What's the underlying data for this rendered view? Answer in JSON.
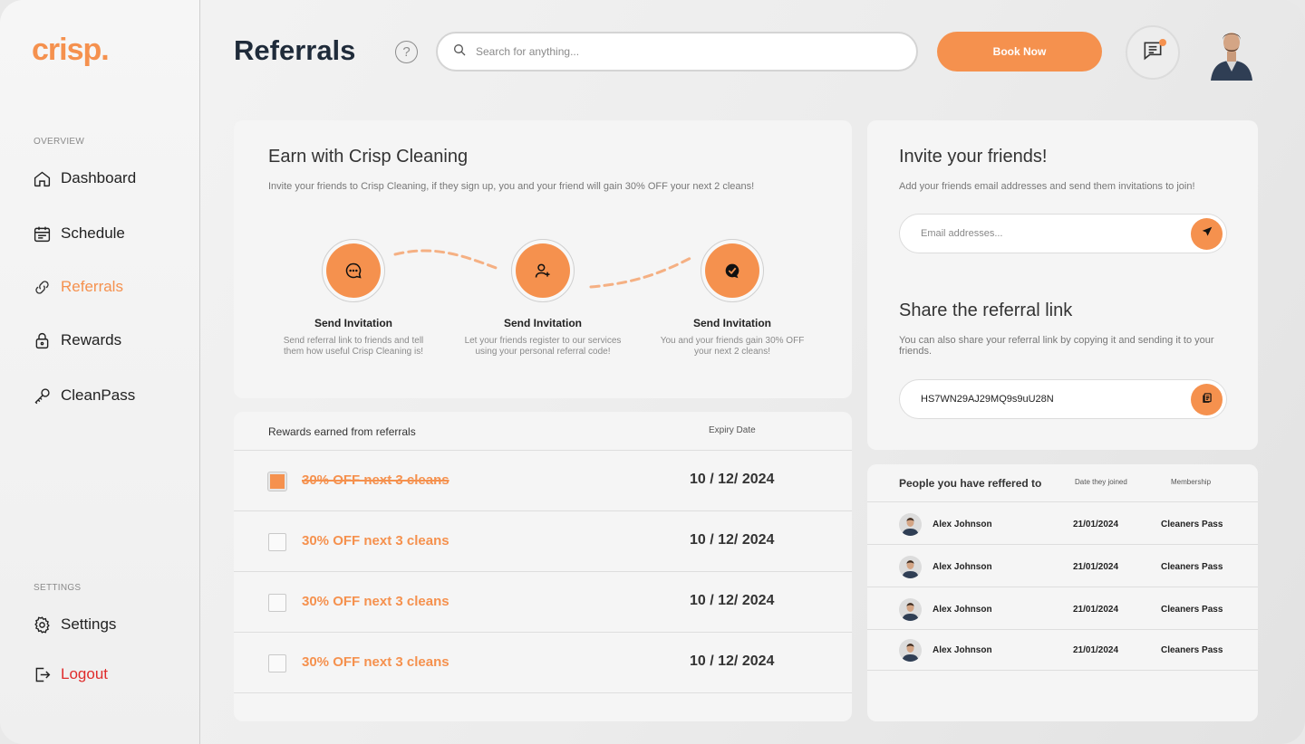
{
  "brand": {
    "logo": "crisp.",
    "accent": "#f5914e"
  },
  "sidebar": {
    "overview_label": "OVERVIEW",
    "settings_label": "SETTINGS",
    "items": [
      {
        "label": "Dashboard",
        "icon": "home-icon"
      },
      {
        "label": "Schedule",
        "icon": "calendar-icon"
      },
      {
        "label": "Referrals",
        "icon": "link-icon",
        "active": true
      },
      {
        "label": "Rewards",
        "icon": "lock-icon"
      },
      {
        "label": "CleanPass",
        "icon": "key-icon"
      }
    ],
    "settings_items": [
      {
        "label": "Settings",
        "icon": "gear-icon"
      },
      {
        "label": "Logout",
        "icon": "logout-icon"
      }
    ]
  },
  "header": {
    "title": "Referrals",
    "help": "?",
    "search_placeholder": "Search for anything...",
    "book_label": "Book Now"
  },
  "earn": {
    "title": "Earn with Crisp Cleaning",
    "subtitle": "Invite your friends to Crisp Cleaning, if they sign up, you and your friend will gain 30% OFF your next 2 cleans!",
    "steps": [
      {
        "title": "Send Invitation",
        "desc1": "Send referral link to friends and tell",
        "desc2": "them how useful Crisp Cleaning is!",
        "icon": "chat-icon"
      },
      {
        "title": "Send Invitation",
        "desc1": "Let your friends register  to our services",
        "desc2": "using your personal referral code!",
        "icon": "user-plus-icon"
      },
      {
        "title": "Send Invitation",
        "desc1": "You and your friends gain 30% OFF",
        "desc2": "your next 2 cleans!",
        "icon": "check-badge-icon"
      }
    ]
  },
  "rewards": {
    "header_label": "Rewards earned from referrals",
    "expiry_label": "Expiry Date",
    "rows": [
      {
        "label": "30% OFF next 3 cleans",
        "date": "10 / 12/ 2024",
        "checked": true
      },
      {
        "label": "30% OFF next 3 cleans",
        "date": "10 / 12/ 2024",
        "checked": false
      },
      {
        "label": "30% OFF next 3 cleans",
        "date": "10 / 12/ 2024",
        "checked": false
      },
      {
        "label": "30% OFF next 3 cleans",
        "date": "10 / 12/ 2024",
        "checked": false
      }
    ]
  },
  "invite": {
    "title": "Invite your friends!",
    "subtitle": "Add your friends email addresses and send them invitations to join!",
    "email_placeholder": "Email addresses...",
    "share_title": "Share the referral link",
    "share_subtitle": "You can also share your referral link by copying it and sending it to your friends.",
    "code": "HS7WN29AJ29MQ9s9uU28N"
  },
  "people": {
    "header_label": "People you have reffered to",
    "joined_label": "Date they joined",
    "membership_label": "Membership",
    "rows": [
      {
        "name": "Alex Johnson",
        "joined": "21/01/2024",
        "membership": "Cleaners Pass"
      },
      {
        "name": "Alex Johnson",
        "joined": "21/01/2024",
        "membership": "Cleaners Pass"
      },
      {
        "name": "Alex Johnson",
        "joined": "21/01/2024",
        "membership": "Cleaners Pass"
      },
      {
        "name": "Alex Johnson",
        "joined": "21/01/2024",
        "membership": "Cleaners Pass"
      }
    ]
  }
}
